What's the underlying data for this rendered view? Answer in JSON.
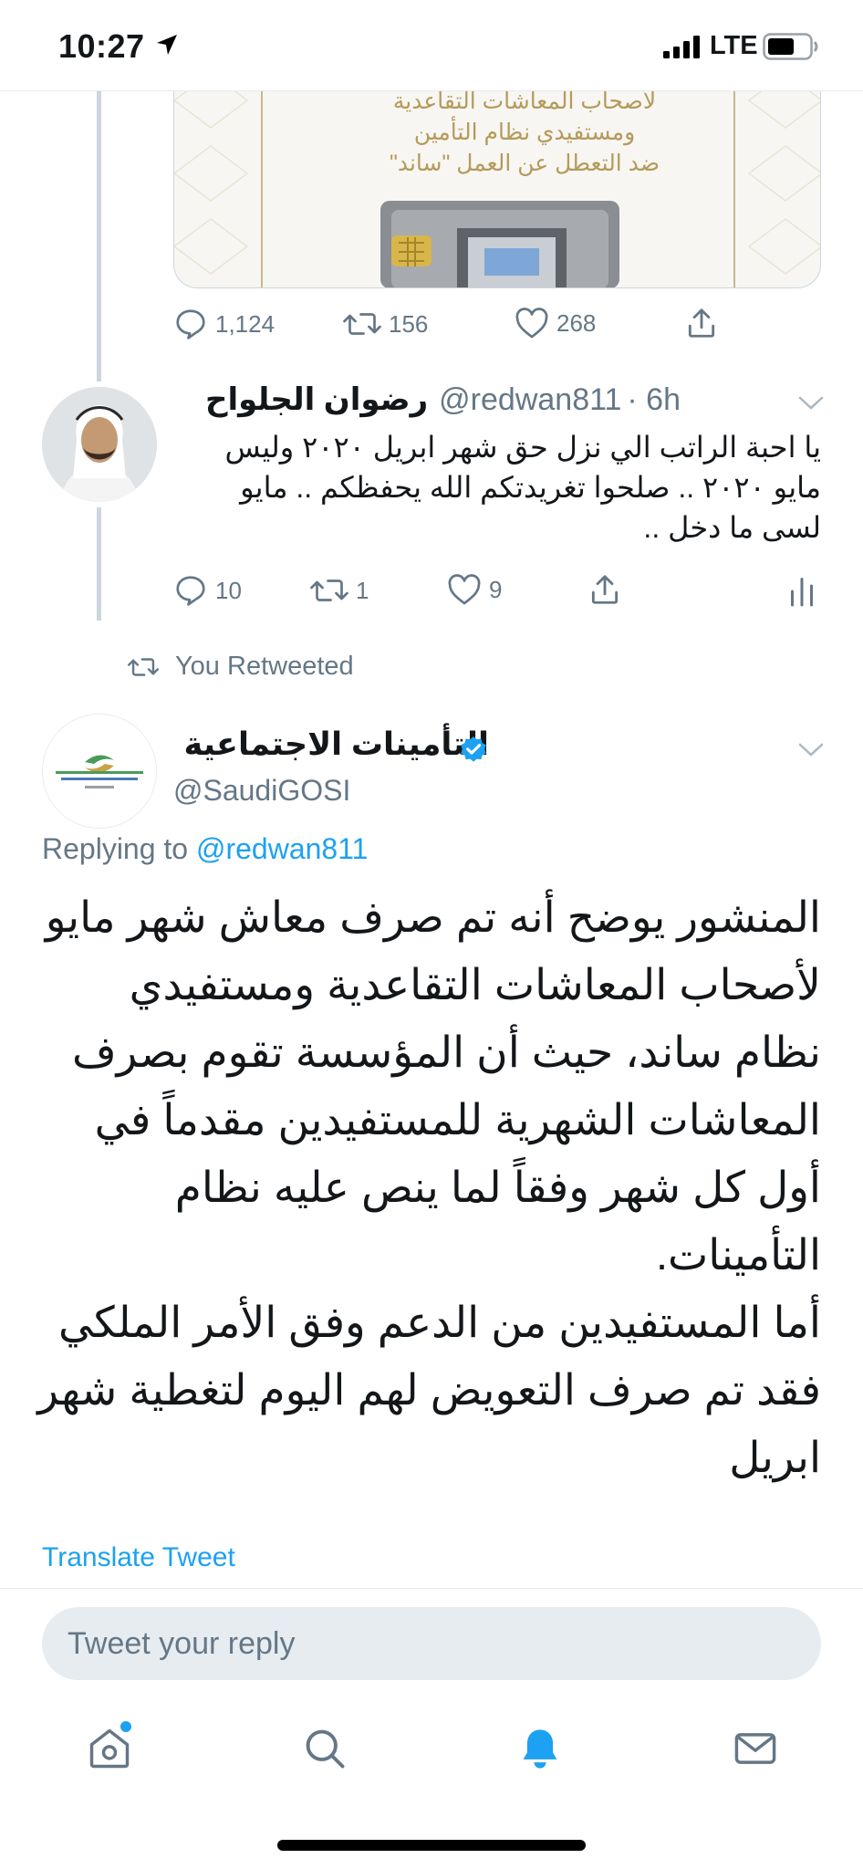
{
  "status_bar": {
    "time": "10:27",
    "network": "LTE"
  },
  "media_card": {
    "lines": [
      "لأصحاب المعاشات التقاعدية",
      "ومستفيدي نظام التأمين",
      "ضد التعطل عن العمل \"ساند\""
    ]
  },
  "tweet1_actions": {
    "replies": "1,124",
    "retweets": "156",
    "likes": "268"
  },
  "tweet2": {
    "display_name": "رضوان الجلواح",
    "handle": "@redwan811",
    "time": "· 6h",
    "text": "يا احبة الراتب الي نزل حق شهر ابريل ٢٠٢٠ وليس مايو ٢٠٢٠ .. صلحوا تغريدتكم الله يحفظكم .. مايو لسى ما دخل ..",
    "replies": "10",
    "retweets": "1",
    "likes": "9"
  },
  "retweeted_label": "You Retweeted",
  "main_tweet": {
    "display_name": "التأمينات الاجتماعية",
    "handle": "@SaudiGOSI",
    "replying_prefix": "Replying to ",
    "replying_to": "@redwan811",
    "text": "المنشور يوضح أنه تم صرف معاش شهر مايو لأصحاب المعاشات التقاعدية ومستفيدي نظام ساند، حيث أن المؤسسة تقوم بصرف المعاشات الشهرية للمستفيدين مقدماً في أول كل شهر وفقاً لما ينص عليه نظام التأمينات.\nأما المستفيدين من الدعم وفق الأمر الملكي فقد تم صرف التعويض لهم اليوم لتغطية شهر ابريل",
    "translate_label": "Translate Tweet"
  },
  "reply_box": {
    "placeholder": "Tweet your reply"
  },
  "colors": {
    "accent": "#1da1f2",
    "secondary_text": "#657786",
    "divider": "#e6ecf0",
    "gold": "#b59a5a"
  },
  "tabs": [
    "home-icon",
    "search-icon",
    "notifications-icon",
    "messages-icon"
  ]
}
